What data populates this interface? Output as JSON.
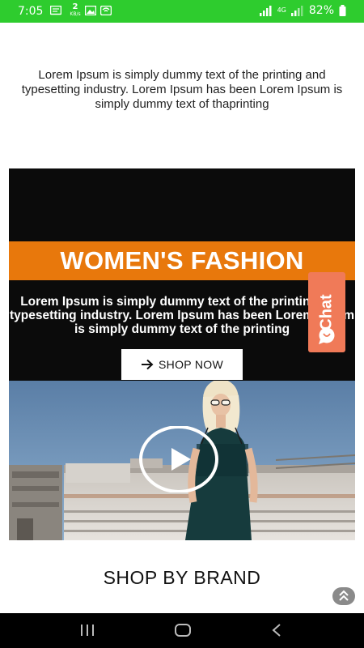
{
  "status_bar": {
    "time": "7:05",
    "net_speed_value": "2",
    "net_speed_unit": "KB/s",
    "network_type": "4G",
    "battery_percent": "82%"
  },
  "intro": {
    "text": "Lorem Ipsum is simply dummy text of the printing and typesetting industry. Lorem Ipsum has been Lorem Ipsum is simply dummy text of  thaprinting"
  },
  "hero": {
    "title": "WOMEN'S FASHION",
    "description": "Lorem Ipsum is simply dummy text of the printing and typesetting industry. Lorem Ipsum has been Lorem Ipsum is simply dummy text of the printing",
    "button_label": "SHOP NOW"
  },
  "chat": {
    "label": "Chat"
  },
  "shop_by_brand": {
    "title": "SHOP BY BRAND"
  },
  "colors": {
    "status_bar": "#2ecc2e",
    "hero_band": "#e8780c",
    "chat_button": "#f07a58"
  },
  "icons": {
    "status_left": [
      "message-icon",
      "image-icon",
      "wifi-icon"
    ],
    "status_right": [
      "signal-icon",
      "battery-icon"
    ],
    "hero_button": "arrow-right-icon",
    "video": "play-icon",
    "chat": "chat-bubble-icon",
    "scroll": "double-chevron-up-icon",
    "nav": [
      "recent-apps-icon",
      "home-icon",
      "back-icon"
    ]
  }
}
